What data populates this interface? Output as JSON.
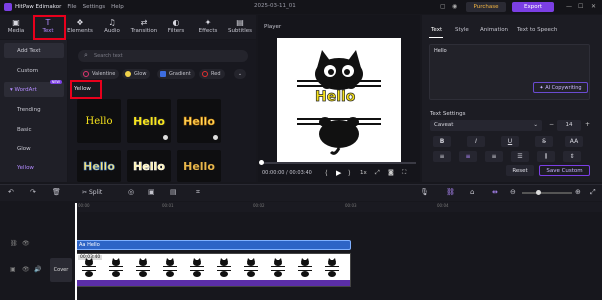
{
  "app": {
    "name": "HitPaw Edimakor",
    "menus": [
      "File",
      "Settings",
      "Help"
    ],
    "doc_title": "2025-03-11_01"
  },
  "titlebar": {
    "purchase_label": "Purchase",
    "export_label": "Export"
  },
  "left_tabs": [
    "Media",
    "Text",
    "Elements",
    "Audio",
    "Transition",
    "Filters",
    "Effects",
    "Subtitles"
  ],
  "categories": {
    "add_text": "Add Text",
    "custom": "Custom",
    "wordart": "WordArt",
    "new_badge": "NEW",
    "trending": "Trending",
    "basic": "Basic",
    "glow": "Glow",
    "yellow": "Yellow"
  },
  "search": {
    "placeholder": "Search text"
  },
  "chips": [
    {
      "label": "Valentine",
      "color": "#e0356f"
    },
    {
      "label": "Glow",
      "color": "#f0d24a"
    },
    {
      "label": "Gradient",
      "color": "#3d6de0"
    },
    {
      "label": "Red",
      "color": "#e23030"
    }
  ],
  "section_title": "Yellow",
  "tiles": [
    "Hello",
    "Hello",
    "Hello",
    "Hello",
    "Hello",
    "Hello"
  ],
  "player": {
    "label": "Player",
    "canvas_text": "Hello",
    "time_current": "00:00:00",
    "time_total": "00:03:40",
    "speed": "1x"
  },
  "right_panel": {
    "tabs": [
      "Text",
      "Style",
      "Animation",
      "Text to Speech"
    ],
    "text_value": "Hello",
    "ai_label": "AI Copywriting",
    "settings_label": "Text Settings",
    "font": "Caveat",
    "font_size": "14",
    "reset_label": "Reset",
    "save_label": "Save Custom"
  },
  "timeline": {
    "split_label": "Split",
    "ruler": [
      "00:00",
      "00:01",
      "00:02",
      "00:03",
      "00:04"
    ],
    "text_clip": "Aa  Hello",
    "video_duration": "00:03:40",
    "cover_label": "Cover"
  },
  "colors": {
    "accent": "#7b3fe4",
    "highlight": "#e8001c",
    "clip_blue": "#2d64c6",
    "yellow": "#f5e11c"
  }
}
